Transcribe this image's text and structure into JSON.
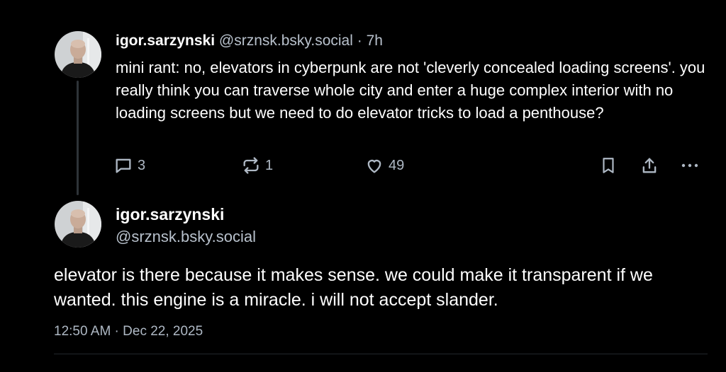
{
  "parent_post": {
    "display_name": "igor.sarzynski",
    "handle": "@srznsk.bsky.social",
    "separator": "·",
    "age": "7h",
    "text": "mini rant: no, elevators in cyberpunk are not 'cleverly concealed loading screens'. you really think you can traverse whole city and enter a huge complex interior with no loading screens but we need to do elevator tricks to load a penthouse?",
    "actions": {
      "reply_icon": "reply-bubble-icon",
      "reply_count": "3",
      "repost_icon": "repost-icon",
      "repost_count": "1",
      "like_icon": "heart-icon",
      "like_count": "49",
      "bookmark_icon": "bookmark-icon",
      "share_icon": "share-icon",
      "more_icon": "more-dots-icon"
    }
  },
  "reply_post": {
    "display_name": "igor.sarzynski",
    "handle": "@srznsk.bsky.social",
    "text": "elevator is there because it makes sense. we could make it transparent if we wanted. this engine is a miracle. i will not accept slander.",
    "timestamp": "12:50 AM · Dec 22, 2025"
  },
  "colors": {
    "background": "#000000",
    "text": "#ffffff",
    "muted": "#aeb8c4",
    "thread_line": "#2e3338"
  }
}
